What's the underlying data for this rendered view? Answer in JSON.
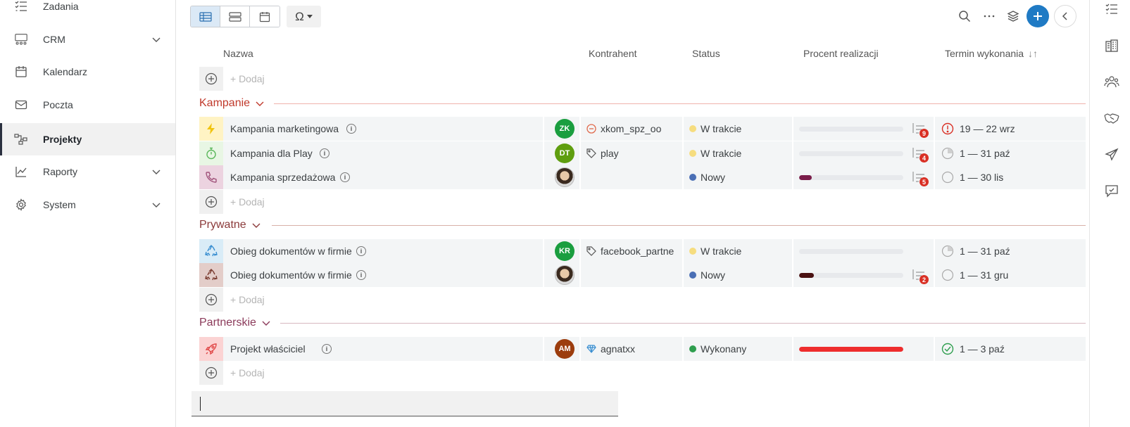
{
  "sidebar": {
    "items": [
      {
        "label": "Zadania",
        "icon": "task-list-icon"
      },
      {
        "label": "CRM",
        "icon": "crm-icon",
        "expandable": true
      },
      {
        "label": "Kalendarz",
        "icon": "calendar-icon"
      },
      {
        "label": "Poczta",
        "icon": "mail-icon"
      },
      {
        "label": "Projekty",
        "icon": "projects-icon",
        "active": true
      },
      {
        "label": "Raporty",
        "icon": "reports-icon",
        "expandable": true
      },
      {
        "label": "System",
        "icon": "settings-icon",
        "expandable": true
      }
    ]
  },
  "toolbar": {
    "views": [
      "table-view-icon",
      "list-view-icon",
      "calendar-view-icon"
    ],
    "active_view": "table-view-icon",
    "group_by_icon": "omega-icon"
  },
  "columns": {
    "name": "Nazwa",
    "contractor": "Kontrahent",
    "status": "Status",
    "progress": "Procent realizacji",
    "deadline": "Termin wykonania",
    "deadline_sort": "↓↑"
  },
  "add_label": "+ Dodaj",
  "groups": [
    {
      "title": "Kampanie",
      "color": "#c0392b",
      "line_color": "#f0b3ad",
      "rows": [
        {
          "name": "Kampania marketingowa",
          "icon": "lightning-icon",
          "icon_bg": "#fff3c4",
          "icon_color": "#f1c40f",
          "avatar": "ZK",
          "avatar_color": "#1a9e3f",
          "contractor": "xkom_spz_oo",
          "contractor_icon": "minus-circle-icon",
          "status": "W trakcie",
          "status_color": "#f6dd7f",
          "progress": 0,
          "progress_color": "#7a1d4a",
          "tasks": "9",
          "deadline": "19 — 22 wrz",
          "deadline_icon": "alert-icon"
        },
        {
          "name": "Kampania dla Play",
          "icon": "stopwatch-icon",
          "icon_bg": "#e8f6e4",
          "icon_color": "#5cb85c",
          "avatar": "DT",
          "avatar_color": "#5f9e0f",
          "contractor": "play",
          "contractor_icon": "tag-icon",
          "status": "W trakcie",
          "status_color": "#f6dd7f",
          "progress": 0,
          "progress_color": "#7a1d4a",
          "tasks": "4",
          "deadline": "1 — 31 paź",
          "deadline_icon": "pie-quarter-icon"
        },
        {
          "name": "Kampania sprzedażowa",
          "icon": "phone-icon",
          "icon_bg": "#ecd3e0",
          "icon_color": "#a0527a",
          "avatar": "",
          "avatar_photo": true,
          "contractor": "",
          "contractor_icon": "",
          "status": "Nowy",
          "status_color": "#4a6fb5",
          "progress": 12,
          "progress_color": "#7a1d4a",
          "tasks": "5",
          "deadline": "1 — 30 lis",
          "deadline_icon": "empty-circle-icon"
        }
      ]
    },
    {
      "title": "Prywatne",
      "color": "#8b3a3a",
      "line_color": "#d8b0a8",
      "rows": [
        {
          "name": "Obieg dokumentów w firmie",
          "icon": "recycle-icon",
          "icon_bg": "#d9ecf7",
          "icon_color": "#3a8fd1",
          "avatar": "KR",
          "avatar_color": "#1a9e3f",
          "contractor": "facebook_partne",
          "contractor_icon": "tag-icon",
          "status": "W trakcie",
          "status_color": "#f6dd7f",
          "progress": 0,
          "progress_color": "#7a1d4a",
          "tasks": "",
          "deadline": "1 — 31 paź",
          "deadline_icon": "pie-quarter-icon"
        },
        {
          "name": "Obieg dokumentów w firmie",
          "icon": "recycle-icon",
          "icon_bg": "#e3cdc9",
          "icon_color": "#7a3b30",
          "avatar": "",
          "avatar_photo": true,
          "contractor": "",
          "contractor_icon": "",
          "status": "Nowy",
          "status_color": "#4a6fb5",
          "progress": 14,
          "progress_color": "#4a1212",
          "tasks": "2",
          "deadline": "1 — 31 gru",
          "deadline_icon": "empty-circle-icon"
        }
      ]
    },
    {
      "title": "Partnerskie",
      "color": "#8b3a5a",
      "line_color": "#d8b8c0",
      "rows": [
        {
          "name": "Projekt właściciel",
          "icon": "rocket-icon",
          "icon_bg": "#fbd3d3",
          "icon_color": "#e04545",
          "avatar": "AM",
          "avatar_color": "#9c3d0e",
          "contractor": "agnatxx",
          "contractor_icon": "diamond-icon",
          "status": "Wykonany",
          "status_color": "#2e9e4e",
          "progress": 100,
          "progress_color": "#ee2d2d",
          "tasks": "",
          "deadline": "1 — 3 paź",
          "deadline_icon": "check-circle-icon"
        }
      ]
    }
  ],
  "rail": [
    "checklist-icon",
    "building-icon",
    "people-icon",
    "handshake-icon",
    "send-icon",
    "comment-icon"
  ]
}
